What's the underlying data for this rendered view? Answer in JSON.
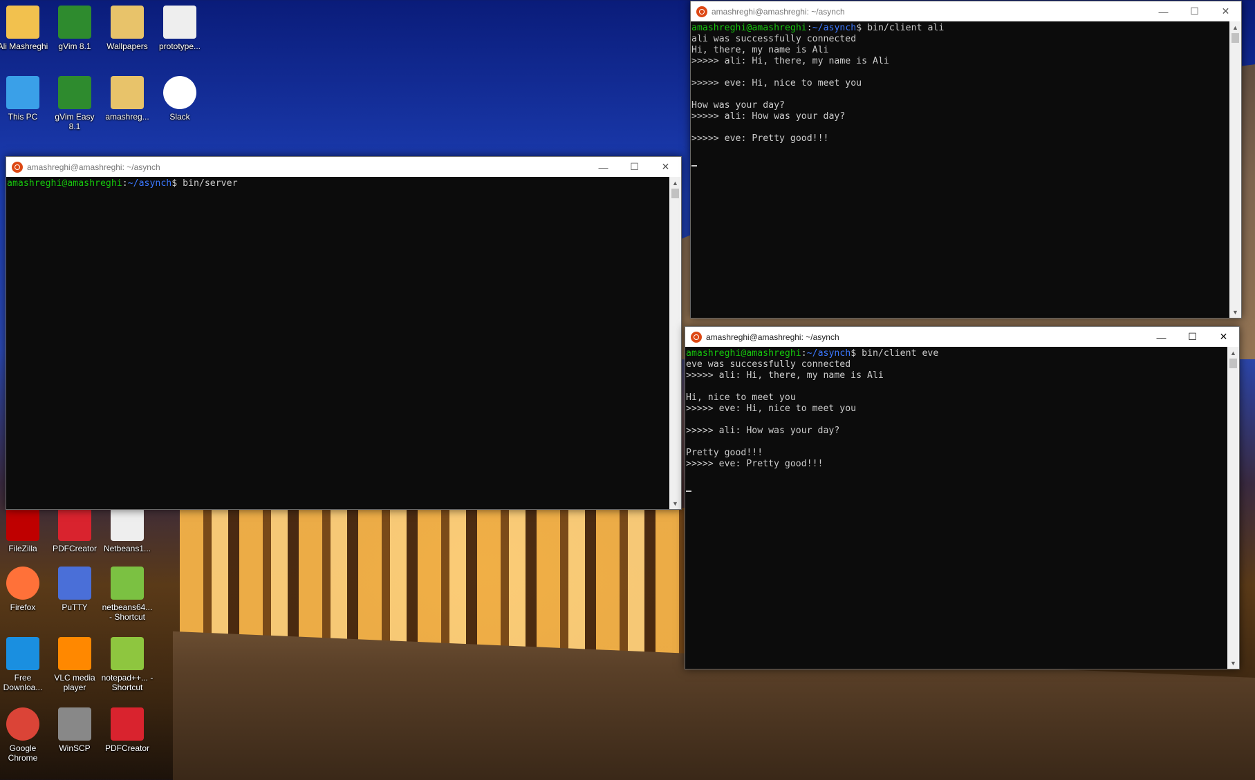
{
  "desktop": {
    "icons": [
      {
        "label": "Ali Mashreghi",
        "icon": "user-folder-icon",
        "color": "#f2c14e"
      },
      {
        "label": "gVim 8.1",
        "icon": "vim-icon",
        "color": "#2e8b2e"
      },
      {
        "label": "Wallpapers",
        "icon": "folder-icon",
        "color": "#e8c36a"
      },
      {
        "label": "prototype...",
        "icon": "document-icon",
        "color": "#eeeeee"
      },
      {
        "label": "This PC",
        "icon": "computer-icon",
        "color": "#3aa0e8"
      },
      {
        "label": "gVim Easy 8.1",
        "icon": "vim-icon",
        "color": "#2e8b2e"
      },
      {
        "label": "amashreg...",
        "icon": "folder-icon",
        "color": "#e8c36a"
      },
      {
        "label": "Slack",
        "icon": "slack-icon",
        "color": "#ffffff"
      },
      {
        "label": "FileZilla",
        "icon": "filezilla-icon",
        "color": "#bf0000"
      },
      {
        "label": "PDFCreator",
        "icon": "pdfcreator-icon",
        "color": "#d9232e"
      },
      {
        "label": "Netbeans1...",
        "icon": "document-icon",
        "color": "#eeeeee"
      },
      {
        "label": "Firefox",
        "icon": "firefox-icon",
        "color": "#ff7139"
      },
      {
        "label": "PuTTY",
        "icon": "putty-icon",
        "color": "#4a6fd8"
      },
      {
        "label": "netbeans64... - Shortcut",
        "icon": "netbeans-icon",
        "color": "#7bc142"
      },
      {
        "label": "Free Downloa...",
        "icon": "download-icon",
        "color": "#1a8fe0"
      },
      {
        "label": "VLC media player",
        "icon": "vlc-icon",
        "color": "#ff8800"
      },
      {
        "label": "notepad++... - Shortcut",
        "icon": "notepad-icon",
        "color": "#8ec63f"
      },
      {
        "label": "Google Chrome",
        "icon": "chrome-icon",
        "color": "#db4437"
      },
      {
        "label": "WinSCP",
        "icon": "winscp-icon",
        "color": "#888888"
      },
      {
        "label": "PDFCreator",
        "icon": "pdfcreator-icon",
        "color": "#d9232e"
      }
    ]
  },
  "windows": {
    "server": {
      "title": "amashreghi@amashreghi: ~/asynch",
      "prompt_user": "amashreghi@amashreghi",
      "prompt_sep": ":",
      "prompt_path": "~/asynch",
      "prompt_end": "$ ",
      "command": "bin/server",
      "lines": []
    },
    "client_ali": {
      "title": "amashreghi@amashreghi: ~/asynch",
      "prompt_user": "amashreghi@amashreghi",
      "prompt_sep": ":",
      "prompt_path": "~/asynch",
      "prompt_end": "$ ",
      "command": "bin/client ali",
      "lines": [
        "ali was successfully connected",
        "Hi, there, my name is Ali",
        ">>>>> ali: Hi, there, my name is Ali",
        "",
        ">>>>> eve: Hi, nice to meet you",
        "",
        "How was your day?",
        ">>>>> ali: How was your day?",
        "",
        ">>>>> eve: Pretty good!!!",
        ""
      ]
    },
    "client_eve": {
      "title": "amashreghi@amashreghi: ~/asynch",
      "prompt_user": "amashreghi@amashreghi",
      "prompt_sep": ":",
      "prompt_path": "~/asynch",
      "prompt_end": "$ ",
      "command": "bin/client eve",
      "lines": [
        "eve was successfully connected",
        ">>>>> ali: Hi, there, my name is Ali",
        "",
        "Hi, nice to meet you",
        ">>>>> eve: Hi, nice to meet you",
        "",
        ">>>>> ali: How was your day?",
        "",
        "Pretty good!!!",
        ">>>>> eve: Pretty good!!!",
        ""
      ]
    }
  },
  "controls": {
    "minimize": "—",
    "maximize": "☐",
    "close": "✕",
    "scroll_up": "▲",
    "scroll_down": "▼"
  }
}
